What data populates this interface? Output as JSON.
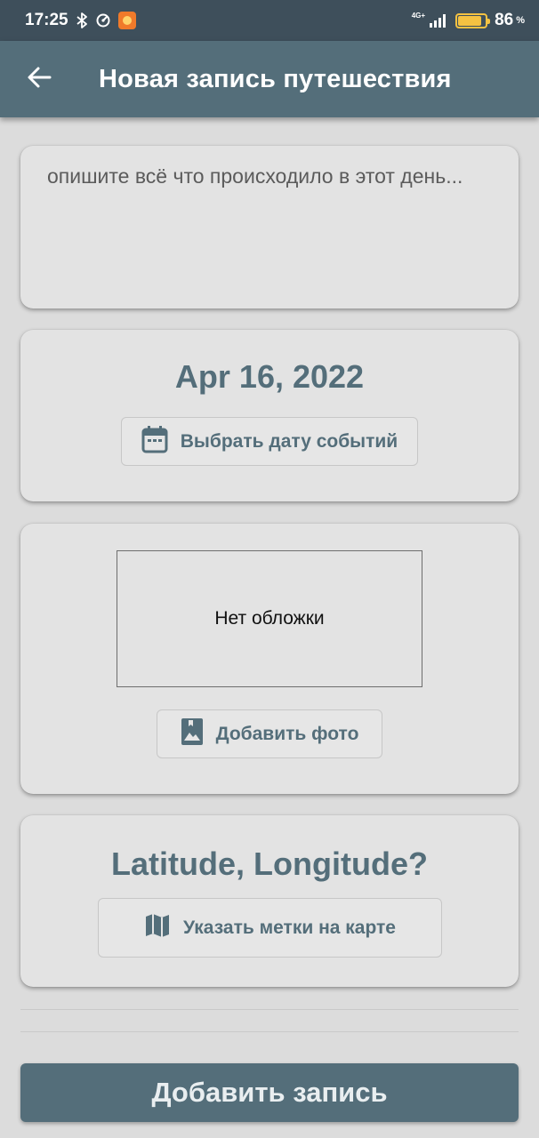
{
  "status_bar": {
    "time": "17:25",
    "network": "4G+",
    "battery_percent": "86",
    "battery_level": 0.86,
    "percent_sign": "%",
    "icons": [
      "bluetooth-icon",
      "timer-icon",
      "app-notification-icon",
      "signal-icon",
      "battery-icon"
    ]
  },
  "app_bar": {
    "title": "Новая запись путешествия",
    "back_icon": "arrow-left-icon"
  },
  "description": {
    "placeholder": "опишите всё что происходило в этот день...",
    "value": ""
  },
  "date_card": {
    "date": "Apr 16, 2022",
    "button_label": "Выбрать дату событий",
    "button_icon": "calendar-icon"
  },
  "photo_card": {
    "cover_placeholder": "Нет обложки",
    "button_label": "Добавить фото",
    "button_icon": "image-icon"
  },
  "location_card": {
    "coordinates": "Latitude, Longitude?",
    "button_label": "Указать метки на карте",
    "button_icon": "map-icon"
  },
  "submit": {
    "label": "Добавить запись"
  },
  "colors": {
    "primary": "#546e7a",
    "status_bar": "#3e4f5b",
    "background": "#dcdcdc",
    "card": "#e3e3e3",
    "battery": "#f5c242"
  }
}
